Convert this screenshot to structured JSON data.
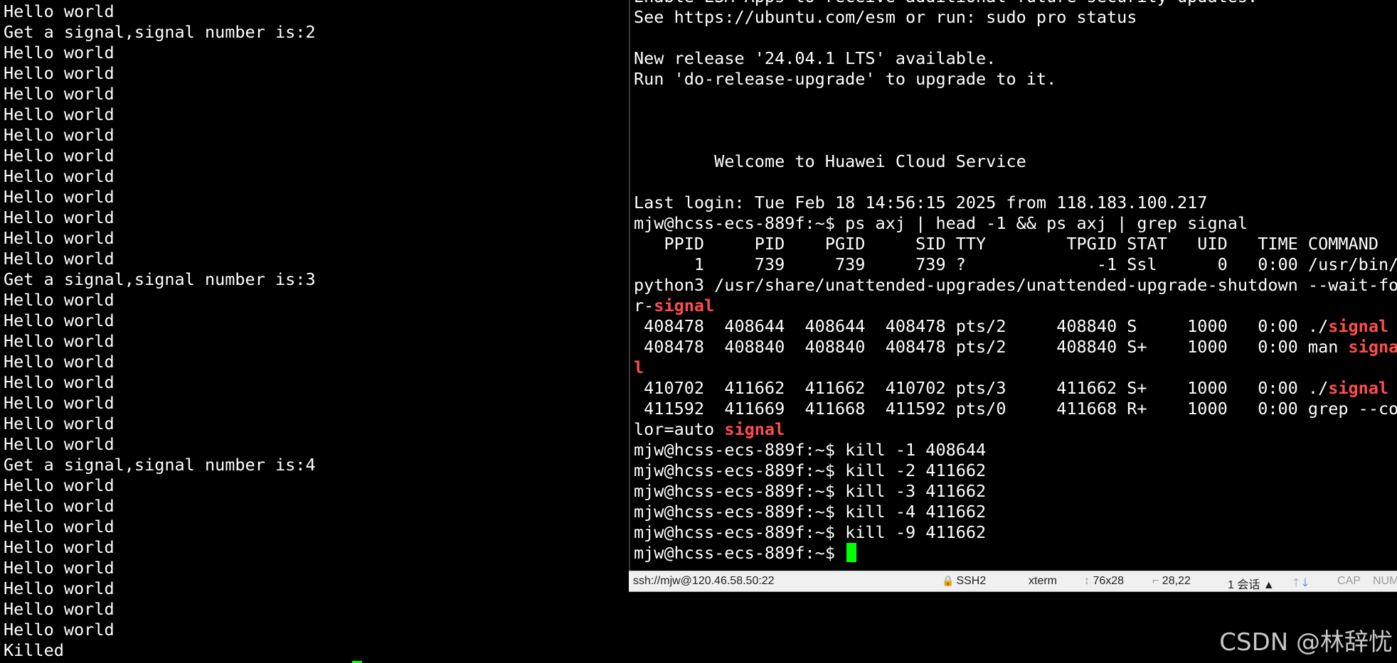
{
  "left_terminal": {
    "lines": [
      "Hello world",
      "Get a signal,signal number is:2",
      "Hello world",
      "Hello world",
      "Hello world",
      "Hello world",
      "Hello world",
      "Hello world",
      "Hello world",
      "Hello world",
      "Hello world",
      "Hello world",
      "Hello world",
      "Get a signal,signal number is:3",
      "Hello world",
      "Hello world",
      "Hello world",
      "Hello world",
      "Hello world",
      "Hello world",
      "Hello world",
      "Hello world",
      "Get a signal,signal number is:4",
      "Hello world",
      "Hello world",
      "Hello world",
      "Hello world",
      "Hello world",
      "Hello world",
      "Hello world",
      "Hello world",
      "Killed"
    ]
  },
  "right_terminal": {
    "l0": "Enable ESM Apps to receive additional future security updates.",
    "l1": "See https://ubuntu.com/esm or run: sudo pro status",
    "l2": "",
    "l3": "New release '24.04.1 LTS' available.",
    "l4": "Run 'do-release-upgrade' to upgrade to it.",
    "l5": "",
    "l6": "",
    "l7": "",
    "l8": "        Welcome to Huawei Cloud Service",
    "l9": "",
    "l10": "Last login: Tue Feb 18 14:56:15 2025 from 118.183.100.217",
    "l11": "mjw@hcss-ecs-889f:~$ ps axj | head -1 && ps axj | grep signal",
    "l12": "   PPID     PID    PGID     SID TTY        TPGID STAT   UID   TIME COMMAND",
    "l13": "      1     739     739     739 ?             -1 Ssl      0   0:00 /usr/bin/",
    "l14": "python3 /usr/share/unattended-upgrades/unattended-upgrade-shutdown --wait-fo",
    "l15a": "r-",
    "l15b": "signal",
    "l16a": " 408478  408644  408644  408478 pts/2     408840 S     1000   0:00 ./",
    "l16b": "signal",
    "l17a": " 408478  408840  408840  408478 pts/2     408840 S+    1000   0:00 man ",
    "l17b": "signa",
    "l18": "l",
    "l19a": " 410702  411662  411662  410702 pts/3     411662 S+    1000   0:00 ./",
    "l19b": "signal",
    "l20": " 411592  411669  411668  411592 pts/0     411668 R+    1000   0:00 grep --co",
    "l21a": "lor=auto ",
    "l21b": "signal",
    "l22": "mjw@hcss-ecs-889f:~$ kill -1 408644",
    "l23": "mjw@hcss-ecs-889f:~$ kill -2 411662",
    "l24": "mjw@hcss-ecs-889f:~$ kill -3 411662",
    "l25": "mjw@hcss-ecs-889f:~$ kill -4 411662",
    "l26": "mjw@hcss-ecs-889f:~$ kill -9 411662",
    "l27": "mjw@hcss-ecs-889f:~$ "
  },
  "status_bar": {
    "connection": "ssh://mjw@120.46.58.50:22",
    "protocol": "SSH2",
    "terminal_type": "xterm",
    "size": "76x28",
    "cursor_pos": "28,22",
    "sessions": "1 会话",
    "cap": "CAP",
    "num": "NUM"
  },
  "colors": {
    "highlight": "#ff4d4d",
    "cursor": "#00ff00",
    "background": "#000000",
    "text": "#ffffff"
  },
  "watermark": "CSDN @林辞忧"
}
